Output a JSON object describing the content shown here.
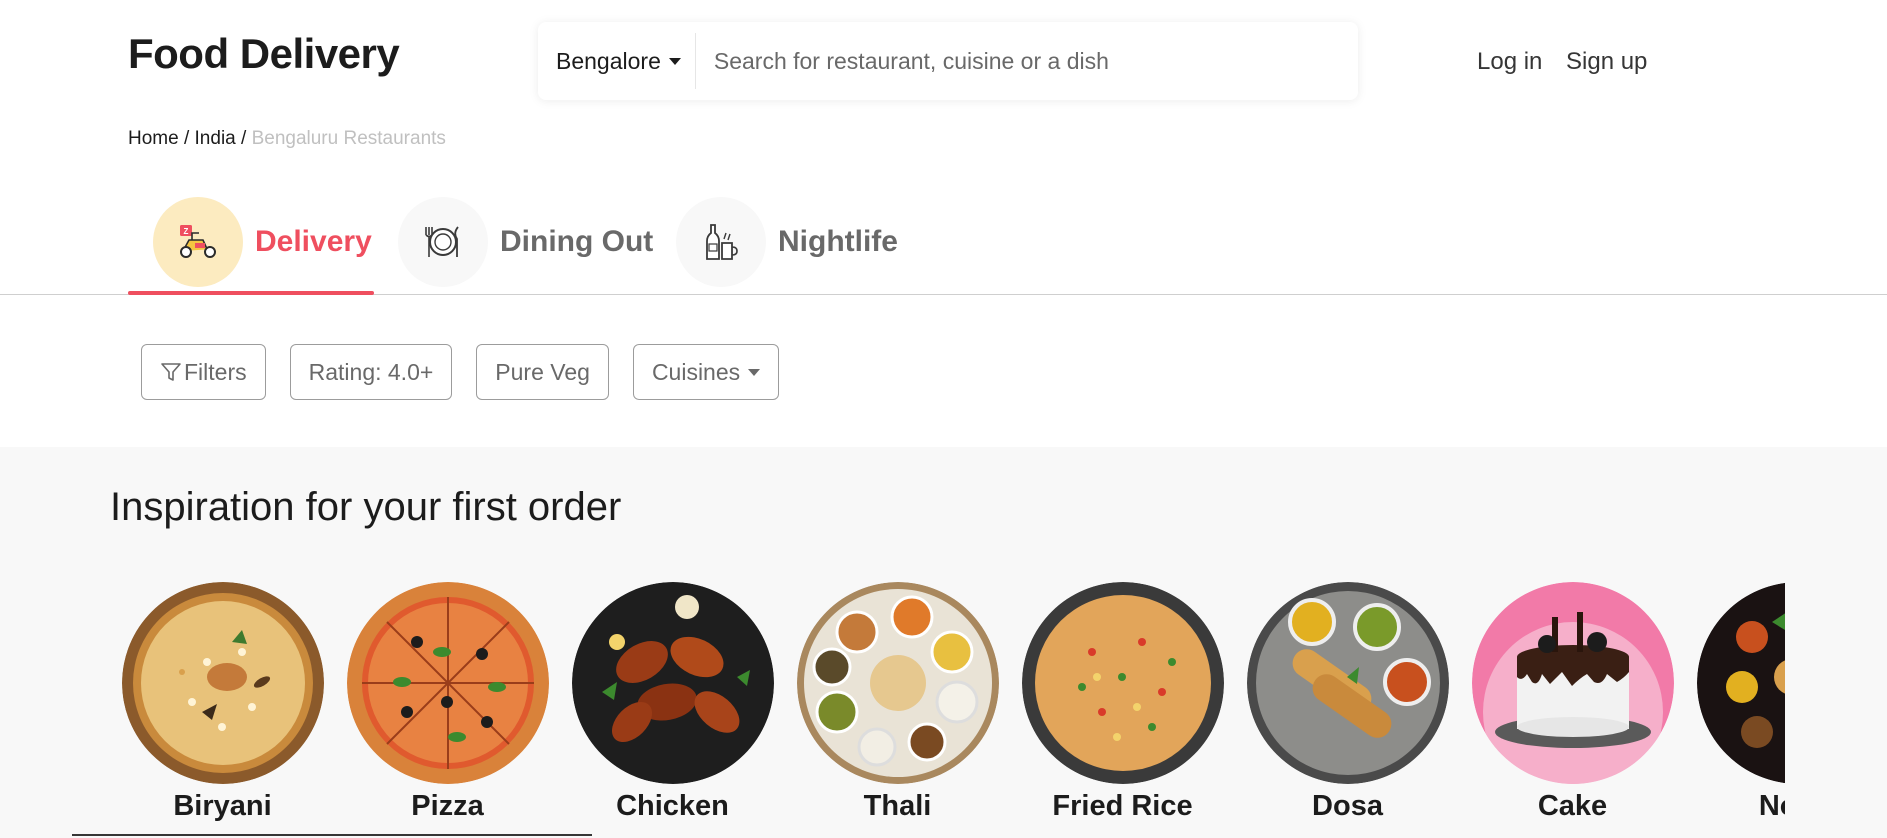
{
  "header": {
    "logo": "Food Delivery",
    "city": "Bengalore",
    "search_placeholder": "Search for restaurant, cuisine or a dish",
    "login": "Log in",
    "signup": "Sign up"
  },
  "breadcrumb": {
    "items": [
      "Home",
      "India"
    ],
    "separator": "/",
    "current": "Bengaluru Restaurants"
  },
  "tabs": [
    {
      "label": "Delivery",
      "icon": "scooter-icon",
      "active": true
    },
    {
      "label": "Dining Out",
      "icon": "plate-cutlery-icon",
      "active": false
    },
    {
      "label": "Nightlife",
      "icon": "bottle-glass-icon",
      "active": false
    }
  ],
  "filters": [
    {
      "label": "Filters",
      "icon": "filter-icon"
    },
    {
      "label": "Rating: 4.0+"
    },
    {
      "label": "Pure Veg"
    },
    {
      "label": "Cuisines",
      "icon": "chevron-down-icon"
    }
  ],
  "inspiration": {
    "title": "Inspiration for your first order",
    "dishes": [
      {
        "name": "Biryani"
      },
      {
        "name": "Pizza"
      },
      {
        "name": "Chicken"
      },
      {
        "name": "Thali"
      },
      {
        "name": "Fried Rice"
      },
      {
        "name": "Dosa"
      },
      {
        "name": "Cake"
      },
      {
        "name": "North"
      }
    ]
  },
  "colors": {
    "accent": "#ef4f5f",
    "delivery_circle": "#fcebc0",
    "section_bg": "#f8f8f8",
    "text_primary": "#1c1c1c",
    "text_muted": "#696969"
  }
}
